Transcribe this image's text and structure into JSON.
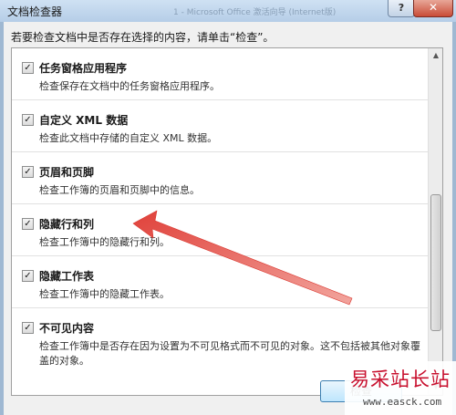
{
  "window": {
    "title": "文档检查器",
    "background_title": "1 - Microsoft Office 激活向导 (Internet版)",
    "help_label": "?",
    "close_label": "✕"
  },
  "instruction": "若要检查文档中是否存在选择的内容，请单击“检查”。",
  "items": [
    {
      "title": "任务窗格应用程序",
      "desc": "检查保存在文档中的任务窗格应用程序。",
      "checked": true
    },
    {
      "title": "自定义 XML 数据",
      "desc": "检查此文档中存储的自定义 XML 数据。",
      "checked": true
    },
    {
      "title": "页眉和页脚",
      "desc": "检查工作簿的页眉和页脚中的信息。",
      "checked": true
    },
    {
      "title": "隐藏行和列",
      "desc": "检查工作簿中的隐藏行和列。",
      "checked": true
    },
    {
      "title": "隐藏工作表",
      "desc": "检查工作簿中的隐藏工作表。",
      "checked": true
    },
    {
      "title": "不可见内容",
      "desc": "检查工作簿中是否存在因为设置为不可见格式而不可见的对象。这不包括被其他对象覆盖的对象。",
      "checked": true
    }
  ],
  "checkbox_glyph": "✓",
  "scroll": {
    "up": "▲",
    "down": "▼"
  },
  "inspect_button": "检查",
  "watermark": {
    "title": "易采站长站",
    "url": "www.easck.com"
  },
  "colors": {
    "arrow": "#e0413a",
    "watermark": "#c8102e",
    "title_bar": "#b5cde7"
  }
}
